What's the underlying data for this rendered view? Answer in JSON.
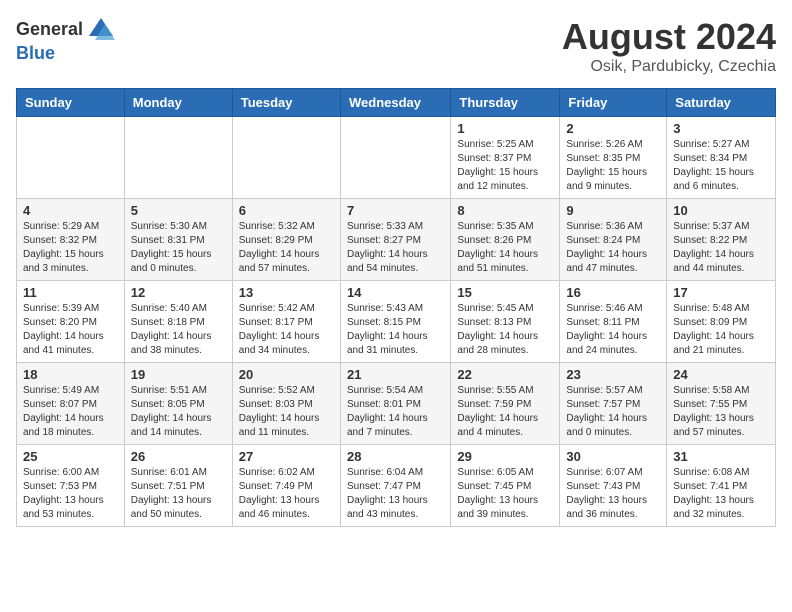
{
  "logo": {
    "general": "General",
    "blue": "Blue"
  },
  "title": "August 2024",
  "location": "Osik, Pardubicky, Czechia",
  "days_of_week": [
    "Sunday",
    "Monday",
    "Tuesday",
    "Wednesday",
    "Thursday",
    "Friday",
    "Saturday"
  ],
  "weeks": [
    [
      {
        "day": "",
        "info": ""
      },
      {
        "day": "",
        "info": ""
      },
      {
        "day": "",
        "info": ""
      },
      {
        "day": "",
        "info": ""
      },
      {
        "day": "1",
        "info": "Sunrise: 5:25 AM\nSunset: 8:37 PM\nDaylight: 15 hours\nand 12 minutes."
      },
      {
        "day": "2",
        "info": "Sunrise: 5:26 AM\nSunset: 8:35 PM\nDaylight: 15 hours\nand 9 minutes."
      },
      {
        "day": "3",
        "info": "Sunrise: 5:27 AM\nSunset: 8:34 PM\nDaylight: 15 hours\nand 6 minutes."
      }
    ],
    [
      {
        "day": "4",
        "info": "Sunrise: 5:29 AM\nSunset: 8:32 PM\nDaylight: 15 hours\nand 3 minutes."
      },
      {
        "day": "5",
        "info": "Sunrise: 5:30 AM\nSunset: 8:31 PM\nDaylight: 15 hours\nand 0 minutes."
      },
      {
        "day": "6",
        "info": "Sunrise: 5:32 AM\nSunset: 8:29 PM\nDaylight: 14 hours\nand 57 minutes."
      },
      {
        "day": "7",
        "info": "Sunrise: 5:33 AM\nSunset: 8:27 PM\nDaylight: 14 hours\nand 54 minutes."
      },
      {
        "day": "8",
        "info": "Sunrise: 5:35 AM\nSunset: 8:26 PM\nDaylight: 14 hours\nand 51 minutes."
      },
      {
        "day": "9",
        "info": "Sunrise: 5:36 AM\nSunset: 8:24 PM\nDaylight: 14 hours\nand 47 minutes."
      },
      {
        "day": "10",
        "info": "Sunrise: 5:37 AM\nSunset: 8:22 PM\nDaylight: 14 hours\nand 44 minutes."
      }
    ],
    [
      {
        "day": "11",
        "info": "Sunrise: 5:39 AM\nSunset: 8:20 PM\nDaylight: 14 hours\nand 41 minutes."
      },
      {
        "day": "12",
        "info": "Sunrise: 5:40 AM\nSunset: 8:18 PM\nDaylight: 14 hours\nand 38 minutes."
      },
      {
        "day": "13",
        "info": "Sunrise: 5:42 AM\nSunset: 8:17 PM\nDaylight: 14 hours\nand 34 minutes."
      },
      {
        "day": "14",
        "info": "Sunrise: 5:43 AM\nSunset: 8:15 PM\nDaylight: 14 hours\nand 31 minutes."
      },
      {
        "day": "15",
        "info": "Sunrise: 5:45 AM\nSunset: 8:13 PM\nDaylight: 14 hours\nand 28 minutes."
      },
      {
        "day": "16",
        "info": "Sunrise: 5:46 AM\nSunset: 8:11 PM\nDaylight: 14 hours\nand 24 minutes."
      },
      {
        "day": "17",
        "info": "Sunrise: 5:48 AM\nSunset: 8:09 PM\nDaylight: 14 hours\nand 21 minutes."
      }
    ],
    [
      {
        "day": "18",
        "info": "Sunrise: 5:49 AM\nSunset: 8:07 PM\nDaylight: 14 hours\nand 18 minutes."
      },
      {
        "day": "19",
        "info": "Sunrise: 5:51 AM\nSunset: 8:05 PM\nDaylight: 14 hours\nand 14 minutes."
      },
      {
        "day": "20",
        "info": "Sunrise: 5:52 AM\nSunset: 8:03 PM\nDaylight: 14 hours\nand 11 minutes."
      },
      {
        "day": "21",
        "info": "Sunrise: 5:54 AM\nSunset: 8:01 PM\nDaylight: 14 hours\nand 7 minutes."
      },
      {
        "day": "22",
        "info": "Sunrise: 5:55 AM\nSunset: 7:59 PM\nDaylight: 14 hours\nand 4 minutes."
      },
      {
        "day": "23",
        "info": "Sunrise: 5:57 AM\nSunset: 7:57 PM\nDaylight: 14 hours\nand 0 minutes."
      },
      {
        "day": "24",
        "info": "Sunrise: 5:58 AM\nSunset: 7:55 PM\nDaylight: 13 hours\nand 57 minutes."
      }
    ],
    [
      {
        "day": "25",
        "info": "Sunrise: 6:00 AM\nSunset: 7:53 PM\nDaylight: 13 hours\nand 53 minutes."
      },
      {
        "day": "26",
        "info": "Sunrise: 6:01 AM\nSunset: 7:51 PM\nDaylight: 13 hours\nand 50 minutes."
      },
      {
        "day": "27",
        "info": "Sunrise: 6:02 AM\nSunset: 7:49 PM\nDaylight: 13 hours\nand 46 minutes."
      },
      {
        "day": "28",
        "info": "Sunrise: 6:04 AM\nSunset: 7:47 PM\nDaylight: 13 hours\nand 43 minutes."
      },
      {
        "day": "29",
        "info": "Sunrise: 6:05 AM\nSunset: 7:45 PM\nDaylight: 13 hours\nand 39 minutes."
      },
      {
        "day": "30",
        "info": "Sunrise: 6:07 AM\nSunset: 7:43 PM\nDaylight: 13 hours\nand 36 minutes."
      },
      {
        "day": "31",
        "info": "Sunrise: 6:08 AM\nSunset: 7:41 PM\nDaylight: 13 hours\nand 32 minutes."
      }
    ]
  ]
}
